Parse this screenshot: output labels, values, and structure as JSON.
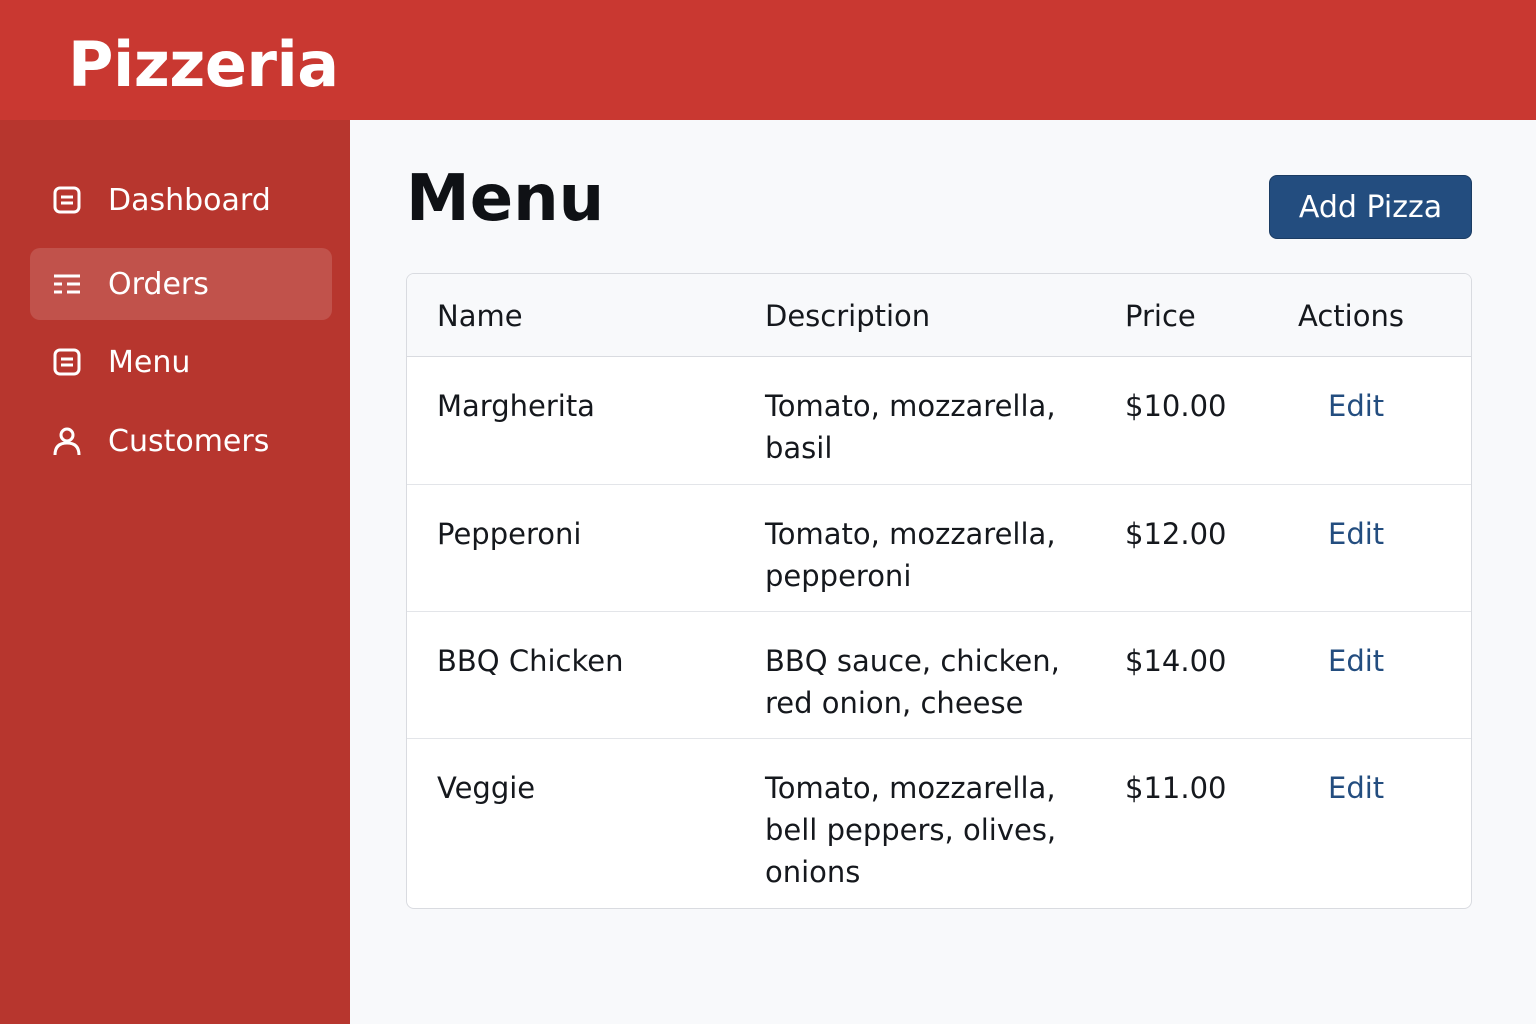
{
  "header": {
    "brand": "Pizzeria",
    "color": "#c93831"
  },
  "sidebar": {
    "color": "#b7362e",
    "items": [
      {
        "label": "Dashboard",
        "icon": "document-icon",
        "active": false
      },
      {
        "label": "Orders",
        "icon": "list-icon",
        "active": true
      },
      {
        "label": "Menu",
        "icon": "document-icon",
        "active": false
      },
      {
        "label": "Customers",
        "icon": "user-icon",
        "active": false
      }
    ]
  },
  "main": {
    "title": "Menu",
    "add_button": "Add Pizza",
    "accent": "#234d7f",
    "table": {
      "columns": [
        "Name",
        "Description",
        "Price",
        "Actions"
      ],
      "rows": [
        {
          "name": "Margherita",
          "description": "Tomato, mozzarella, basil",
          "price": "$10.00",
          "action": "Edit"
        },
        {
          "name": "Pepperoni",
          "description": "Tomato, mozzarella, pepperoni",
          "price": "$12.00",
          "action": "Edit"
        },
        {
          "name": "BBQ Chicken",
          "description": "BBQ sauce, chicken, red onion, cheese",
          "price": "$14.00",
          "action": "Edit"
        },
        {
          "name": "Veggie",
          "description": "Tomato, mozzarella, bell peppers, olives, onions",
          "price": "$11.00",
          "action": "Edit"
        }
      ]
    }
  }
}
